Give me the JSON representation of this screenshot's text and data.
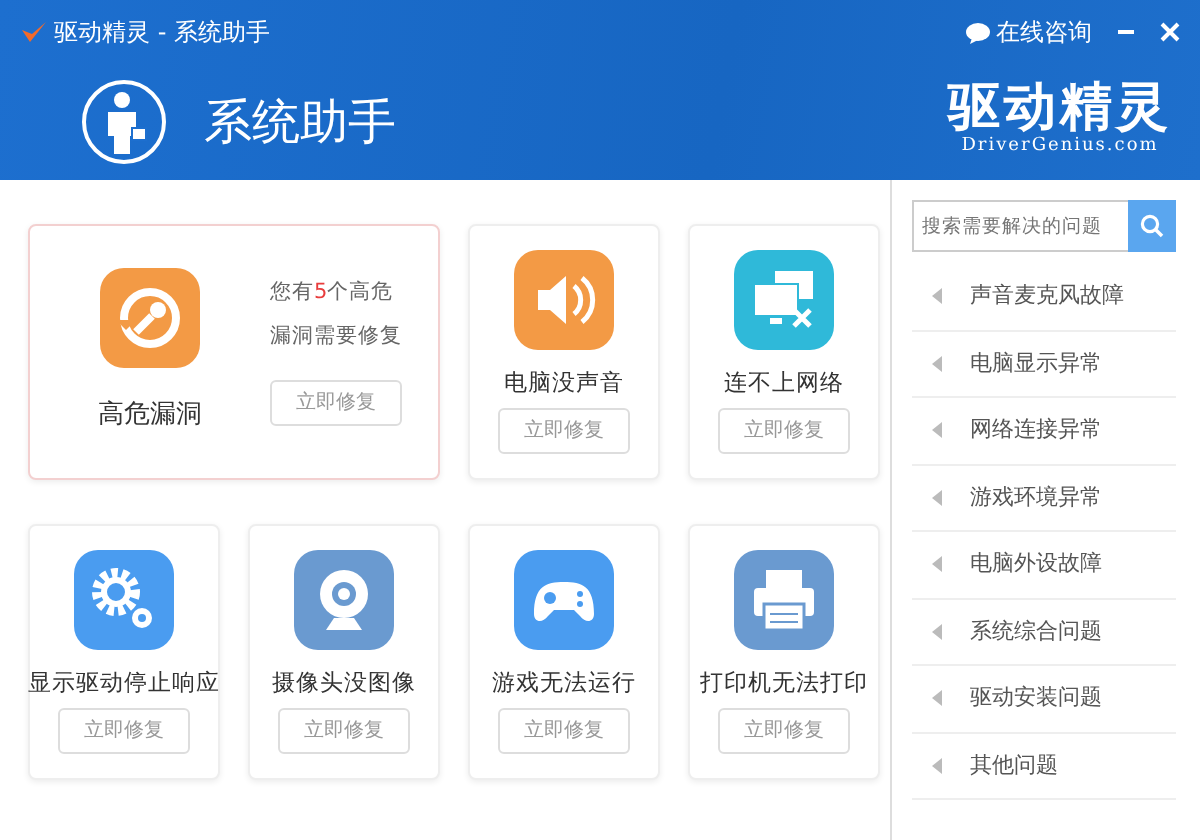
{
  "window": {
    "title": "驱动精灵 - 系统助手",
    "consult_link": "在线咨询"
  },
  "header": {
    "title": "系统助手",
    "logo_text": "驱动精灵",
    "logo_subtext": "DriverGenius.com"
  },
  "featured": {
    "title": "高危漏洞",
    "kind": "repair",
    "color": "#f39a45",
    "message_before": "您有",
    "count": "5",
    "message_after": "个高危",
    "message_line2": "漏洞需要修复",
    "button": "立即修复"
  },
  "cards": [
    {
      "title": "电脑没声音",
      "kind": "speaker",
      "color": "#f39a45",
      "button": "立即修复"
    },
    {
      "title": "连不上网络",
      "kind": "network",
      "color": "#2fb9d9",
      "button": "立即修复"
    },
    {
      "title": "显示驱动停止响应",
      "kind": "gears",
      "color": "#4a9cf0",
      "button": "立即修复"
    },
    {
      "title": "摄像头没图像",
      "kind": "camera",
      "color": "#6a9ad0",
      "button": "立即修复"
    },
    {
      "title": "游戏无法运行",
      "kind": "gamepad",
      "color": "#4a9cf0",
      "button": "立即修复"
    },
    {
      "title": "打印机无法打印",
      "kind": "printer",
      "color": "#6a9ad0",
      "button": "立即修复"
    }
  ],
  "sidebar": {
    "search": {
      "placeholder": "搜索需要解决的问题"
    },
    "items": [
      "声音麦克风故障",
      "电脑显示异常",
      "网络连接异常",
      "游戏环境异常",
      "电脑外设故障",
      "系统综合问题",
      "驱动安装问题",
      "其他问题"
    ]
  }
}
